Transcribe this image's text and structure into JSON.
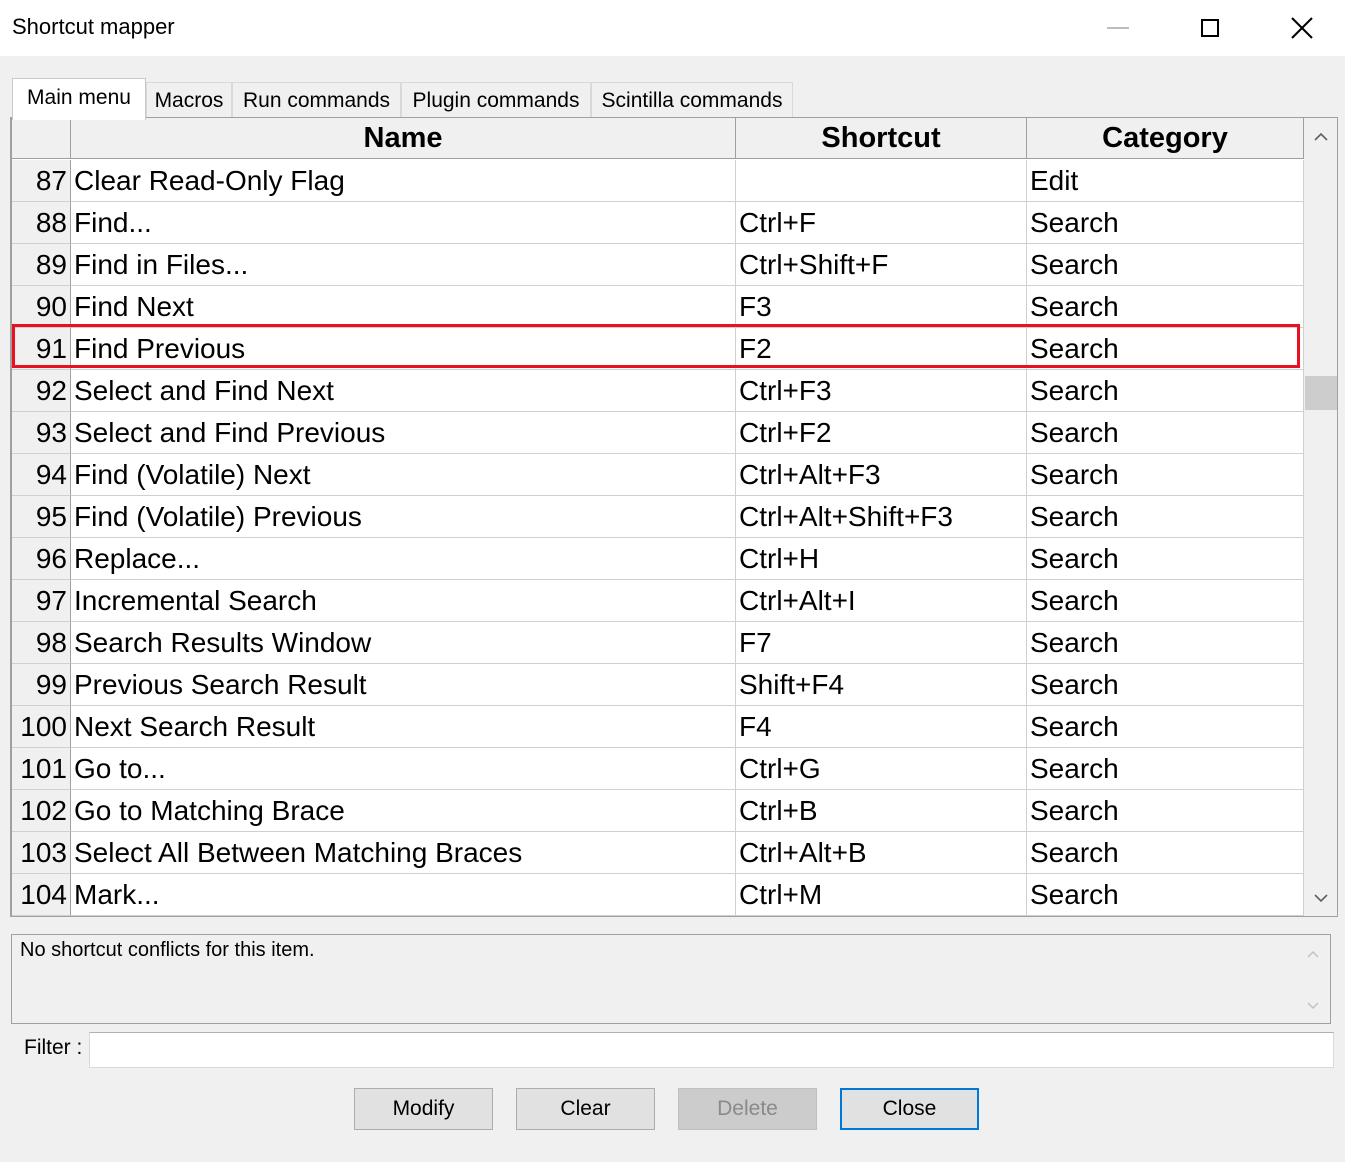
{
  "window": {
    "title": "Shortcut mapper",
    "controls": {
      "minimize": "minimize-icon",
      "maximize": "maximize-icon",
      "close": "close-icon"
    }
  },
  "tabs": [
    {
      "label": "Main menu",
      "active": true
    },
    {
      "label": "Macros",
      "active": false
    },
    {
      "label": "Run commands",
      "active": false
    },
    {
      "label": "Plugin commands",
      "active": false
    },
    {
      "label": "Scintilla commands",
      "active": false
    }
  ],
  "grid": {
    "columns": {
      "number": "",
      "name": "Name",
      "shortcut": "Shortcut",
      "category": "Category"
    },
    "rows": [
      {
        "num": "87",
        "name": "Clear Read-Only Flag",
        "shortcut": "",
        "category": "Edit"
      },
      {
        "num": "88",
        "name": "Find...",
        "shortcut": "Ctrl+F",
        "category": "Search"
      },
      {
        "num": "89",
        "name": "Find in Files...",
        "shortcut": "Ctrl+Shift+F",
        "category": "Search"
      },
      {
        "num": "90",
        "name": "Find Next",
        "shortcut": "F3",
        "category": "Search"
      },
      {
        "num": "91",
        "name": "Find Previous",
        "shortcut": "F2",
        "category": "Search",
        "highlighted": true
      },
      {
        "num": "92",
        "name": "Select and Find Next",
        "shortcut": "Ctrl+F3",
        "category": "Search"
      },
      {
        "num": "93",
        "name": "Select and Find Previous",
        "shortcut": "Ctrl+F2",
        "category": "Search"
      },
      {
        "num": "94",
        "name": "Find (Volatile) Next",
        "shortcut": "Ctrl+Alt+F3",
        "category": "Search"
      },
      {
        "num": "95",
        "name": "Find (Volatile) Previous",
        "shortcut": "Ctrl+Alt+Shift+F3",
        "category": "Search"
      },
      {
        "num": "96",
        "name": "Replace...",
        "shortcut": "Ctrl+H",
        "category": "Search"
      },
      {
        "num": "97",
        "name": "Incremental Search",
        "shortcut": "Ctrl+Alt+I",
        "category": "Search"
      },
      {
        "num": "98",
        "name": "Search Results Window",
        "shortcut": "F7",
        "category": "Search"
      },
      {
        "num": "99",
        "name": "Previous Search Result",
        "shortcut": "Shift+F4",
        "category": "Search"
      },
      {
        "num": "100",
        "name": "Next Search Result",
        "shortcut": "F4",
        "category": "Search"
      },
      {
        "num": "101",
        "name": "Go to...",
        "shortcut": "Ctrl+G",
        "category": "Search"
      },
      {
        "num": "102",
        "name": "Go to Matching Brace",
        "shortcut": "Ctrl+B",
        "category": "Search"
      },
      {
        "num": "103",
        "name": "Select All Between Matching Braces",
        "shortcut": "Ctrl+Alt+B",
        "category": "Search"
      },
      {
        "num": "104",
        "name": "Mark...",
        "shortcut": "Ctrl+M",
        "category": "Search"
      }
    ]
  },
  "conflict": {
    "text": "No shortcut conflicts for this item."
  },
  "filter": {
    "label": "Filter :",
    "value": ""
  },
  "buttons": {
    "modify": "Modify",
    "clear": "Clear",
    "delete": "Delete",
    "close": "Close"
  },
  "colors": {
    "highlight": "#e81123",
    "default_button_border": "#0078d7"
  }
}
